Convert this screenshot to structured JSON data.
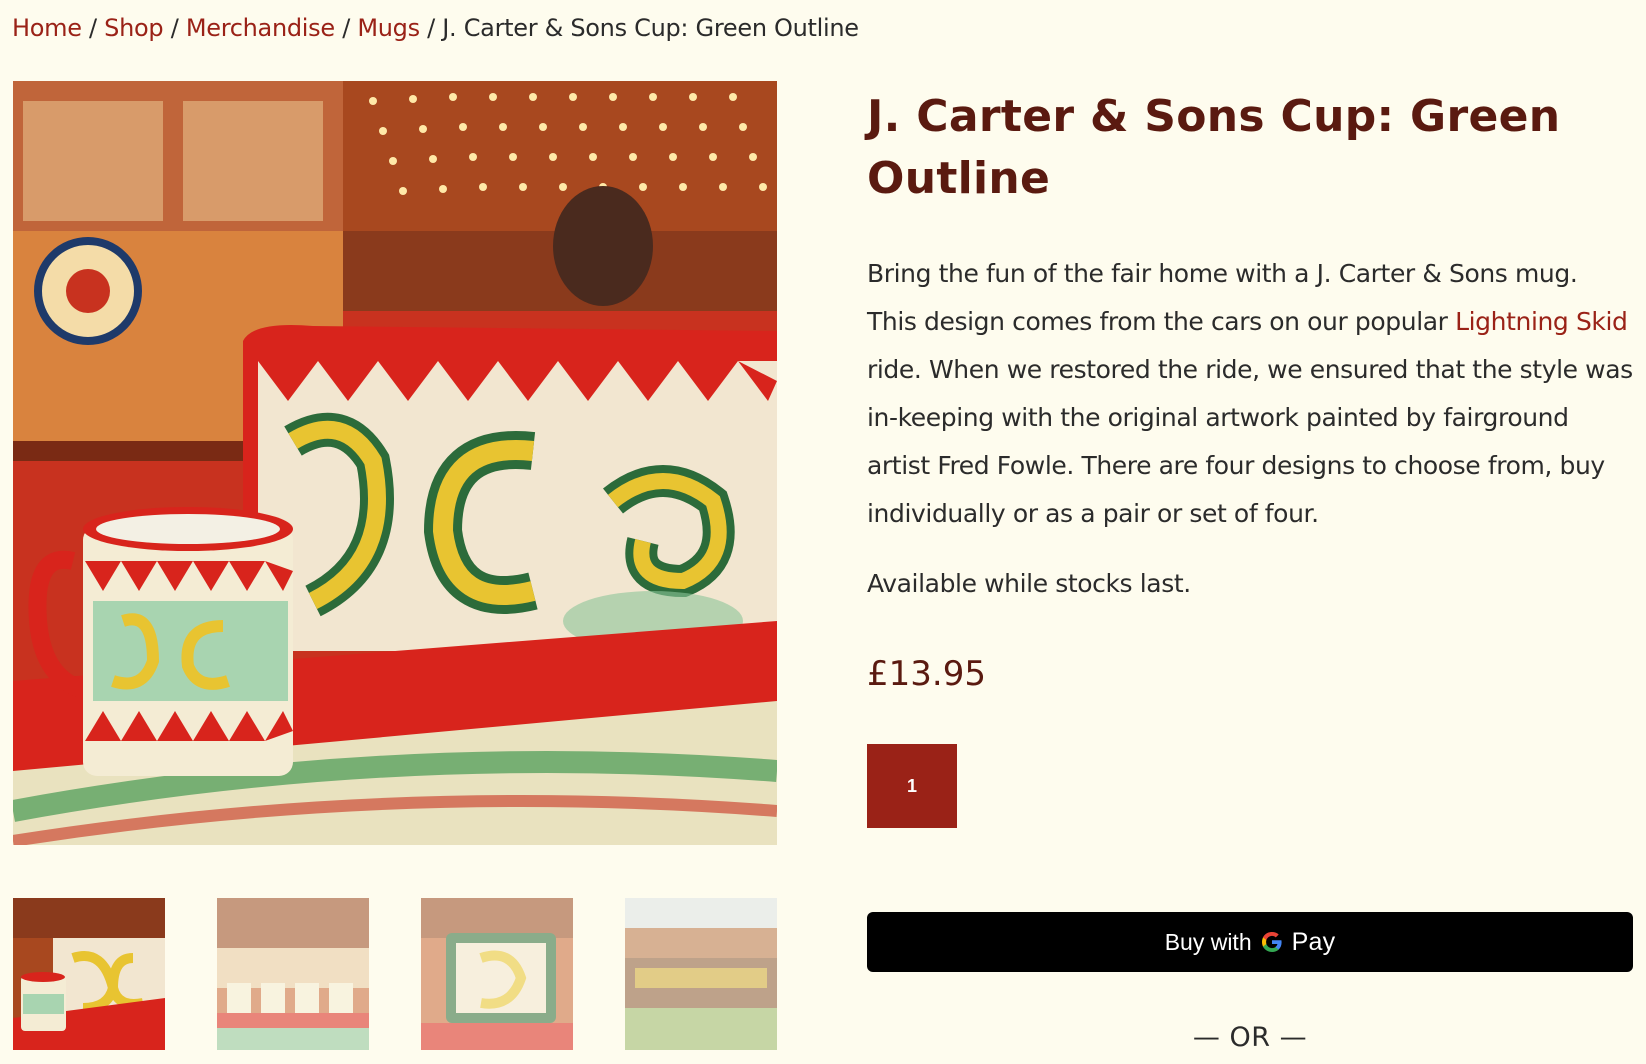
{
  "breadcrumb": {
    "home": "Home",
    "shop": "Shop",
    "merchandise": "Merchandise",
    "mugs": "Mugs",
    "separator": "/",
    "current": "J. Carter & Sons Cup: Green Outline"
  },
  "product": {
    "title": "J. Carter & Sons Cup: Green Outline",
    "description_part1": "Bring the fun of the fair home with a J. Carter & Sons mug. This design comes from the cars on our popular ",
    "description_link": "Lightning Skid",
    "description_part2": " ride. When we restored the ride, we ensured that the style was in-keeping with the original artwork painted by fairground artist Fred Fowle. There are four designs to choose from, buy individually or as a pair or set of four.",
    "availability": "Available while stocks last.",
    "price": "£13.95",
    "quantity": "1"
  },
  "payment": {
    "gpay_prefix": "Buy with",
    "gpay_word": "Pay",
    "or_divider": "— OR —"
  },
  "colors": {
    "background": "#fefcee",
    "link": "#9a2217",
    "title": "#5a1a10",
    "qty_button": "#9a2217"
  }
}
